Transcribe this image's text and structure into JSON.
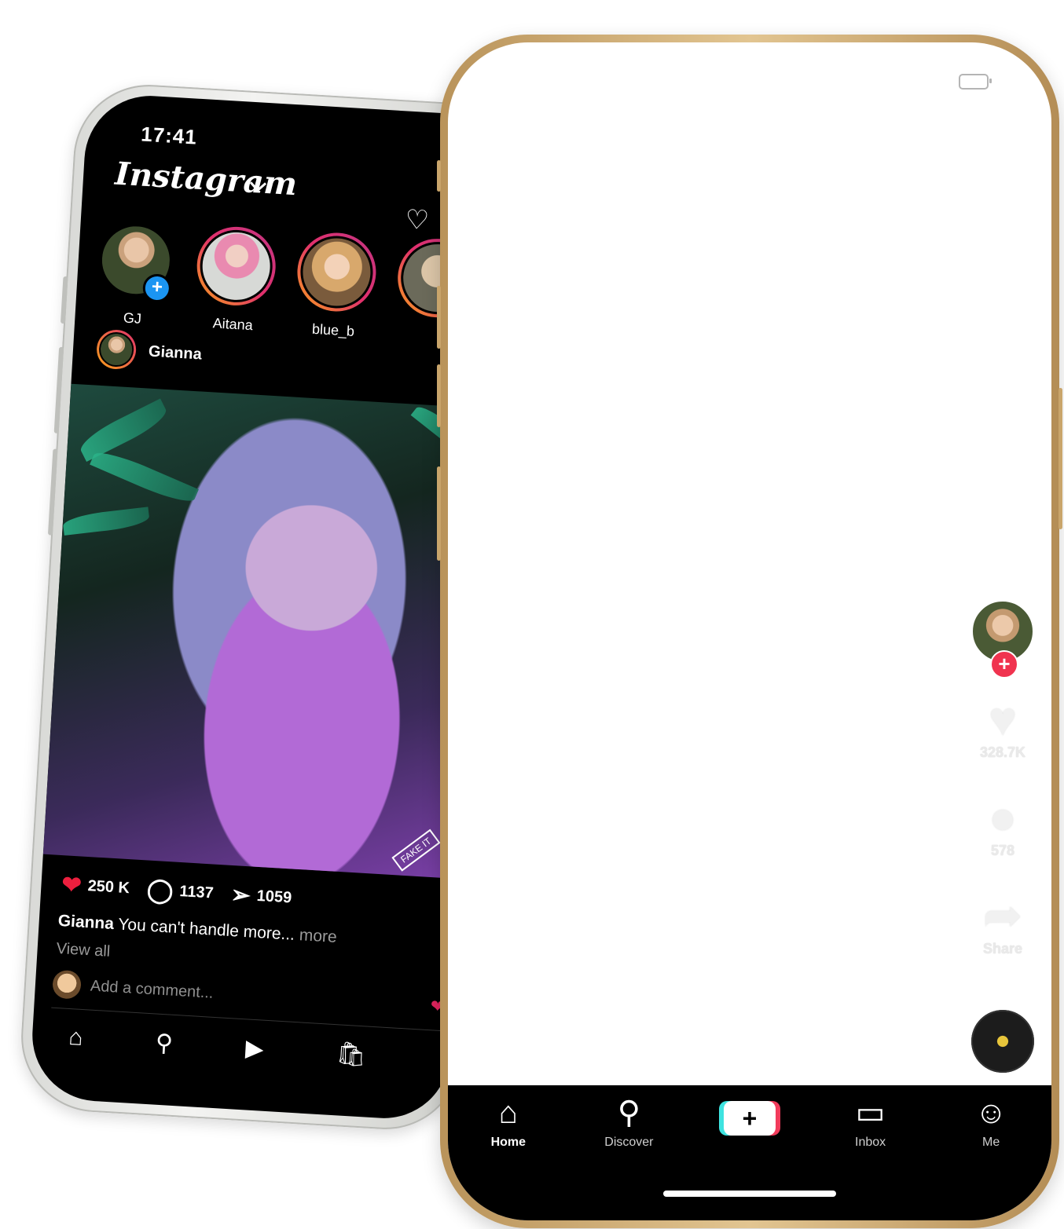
{
  "instagram": {
    "status_time": "17:41",
    "logo": "Instagram",
    "stories": [
      {
        "name": "GJ",
        "has_add": true
      },
      {
        "name": "Aitana",
        "has_add": false
      },
      {
        "name": "blue_b",
        "has_add": false
      },
      {
        "name": "",
        "has_add": false
      }
    ],
    "post": {
      "author": "Gianna",
      "likes": "250 K",
      "comments": "1137",
      "shares": "1059",
      "caption_author": "Gianna",
      "caption_text": "You can't handle more...",
      "caption_more": "more",
      "view_all": "View all",
      "watermark": "FAKE IT",
      "comment_placeholder": "Add a comment..."
    },
    "nav": [
      "home-icon",
      "search-icon",
      "reels-icon",
      "shop-icon"
    ]
  },
  "tiktok": {
    "likes": "328.7K",
    "comments": "578",
    "share_label": "Share",
    "nav": [
      {
        "label": "Home",
        "icon": "home-icon",
        "active": true
      },
      {
        "label": "Discover",
        "icon": "search-icon",
        "active": false
      },
      {
        "label": "",
        "icon": "create-icon",
        "active": false
      },
      {
        "label": "Inbox",
        "icon": "inbox-icon",
        "active": false
      },
      {
        "label": "Me",
        "icon": "profile-icon",
        "active": false
      }
    ],
    "colors": {
      "accent_red": "#f0334f",
      "accent_cyan": "#3ee3e0",
      "frame_gold": "#d8b57b"
    }
  }
}
